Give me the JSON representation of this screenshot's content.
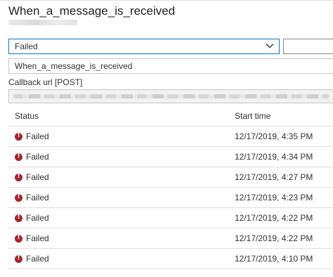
{
  "header": {
    "title": "When_a_message_is_received"
  },
  "filter": {
    "status_select_value": "Failed",
    "trigger_value": "When_a_message_is_received",
    "callback_label": "Callback url [POST]"
  },
  "table": {
    "columns": [
      "Status",
      "Start time"
    ],
    "rows": [
      {
        "status": "Failed",
        "start_time": "12/17/2019, 4:35 PM"
      },
      {
        "status": "Failed",
        "start_time": "12/17/2019, 4:34 PM"
      },
      {
        "status": "Failed",
        "start_time": "12/17/2019, 4:27 PM"
      },
      {
        "status": "Failed",
        "start_time": "12/17/2019, 4:23 PM"
      },
      {
        "status": "Failed",
        "start_time": "12/17/2019, 4:22 PM"
      },
      {
        "status": "Failed",
        "start_time": "12/17/2019, 4:22 PM"
      },
      {
        "status": "Failed",
        "start_time": "12/17/2019, 4:10 PM"
      }
    ]
  },
  "icons": {
    "status": "error-circle-icon",
    "dropdown": "chevron-down-icon"
  },
  "colors": {
    "accent": "#0078d4",
    "error": "#a4262c",
    "divider": "#e1dfdd"
  }
}
